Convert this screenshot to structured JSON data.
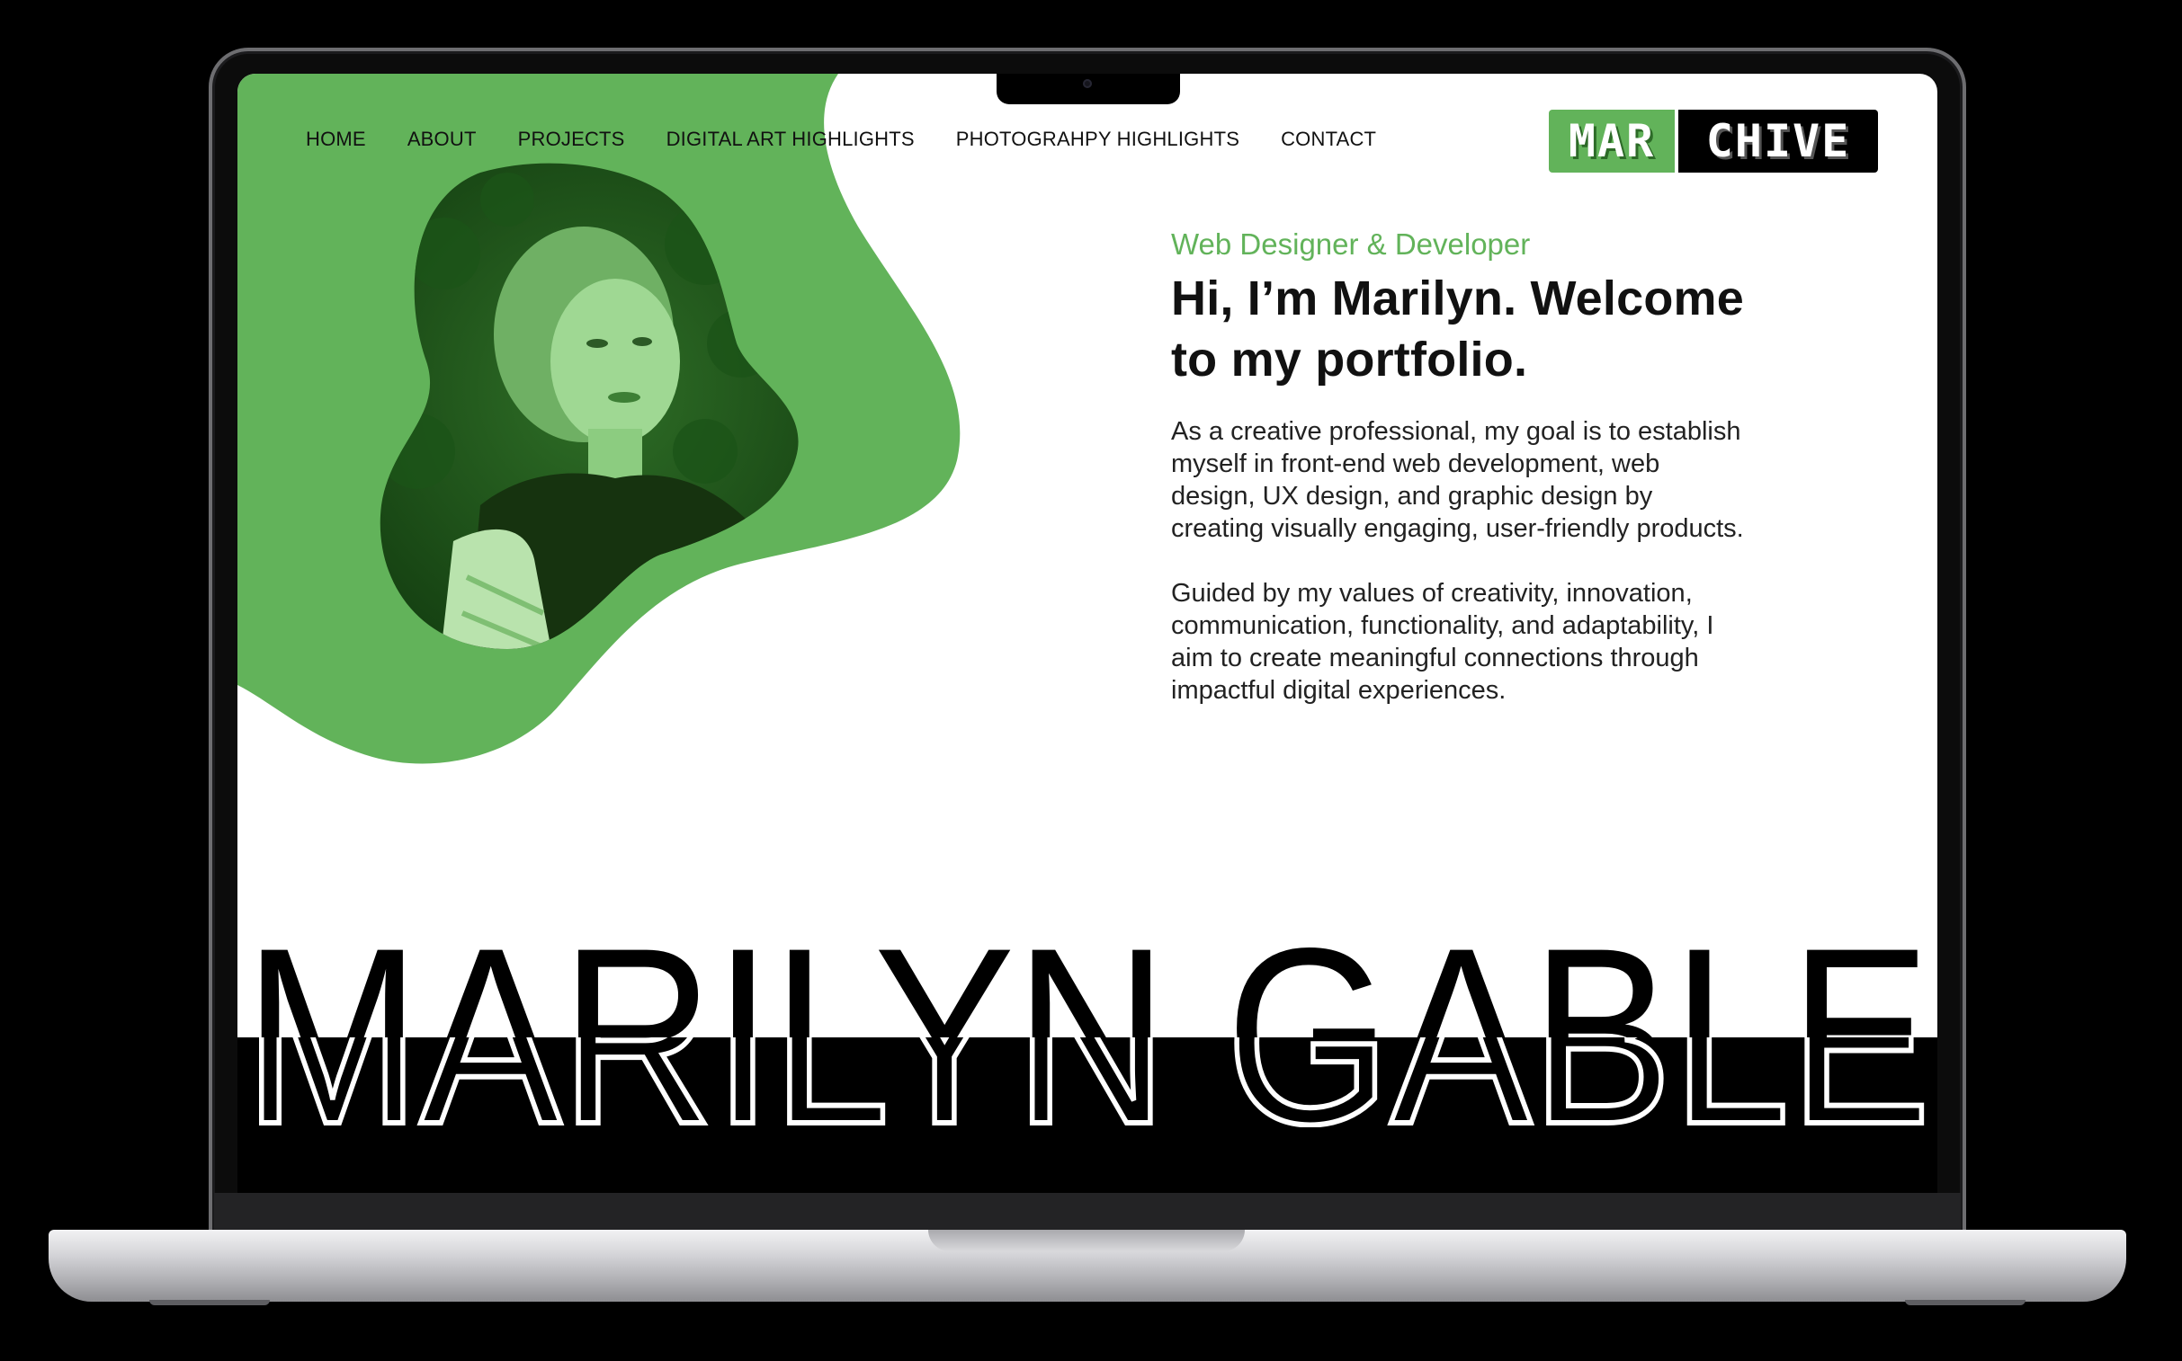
{
  "nav": {
    "items": [
      {
        "label": "HOME"
      },
      {
        "label": "ABOUT"
      },
      {
        "label": "PROJECTS"
      },
      {
        "label": "DIGITAL ART HIGHLIGHTS"
      },
      {
        "label": "PHOTOGRAHPY HIGHLIGHTS"
      },
      {
        "label": "CONTACT"
      }
    ]
  },
  "logo": {
    "part1": "MAR",
    "part2": "CHIVE"
  },
  "hero": {
    "subtitle": "Web Designer & Developer",
    "headline_line1": "Hi, I’m Marilyn. Welcome",
    "headline_line2": "to my portfolio.",
    "paragraph1": "As a creative professional, my goal is to establish myself in front-end web development, web design, UX design, and graphic design by creating visually engaging, user-friendly products.",
    "paragraph2": "Guided by my values of creativity, innovation, communication, functionality, and adaptability, I aim to create meaningful connections through impactful digital experiences."
  },
  "banner": {
    "name": "MARILYN GABLE"
  },
  "colors": {
    "accent": "#62b35a",
    "text": "#111111",
    "background": "#ffffff"
  }
}
